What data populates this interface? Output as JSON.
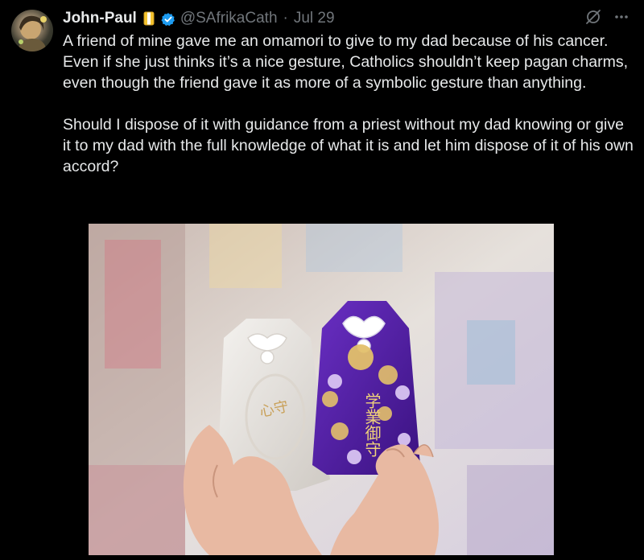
{
  "tweet": {
    "display_name": "John-Paul",
    "handle": "@SAfrikaCath",
    "separator": "·",
    "date": "Jul 29",
    "paragraphs": [
      "A friend of mine gave me an omamori to give to my dad because of his cancer. Even if she just thinks it’s a nice gesture, Catholics shouldn’t keep pagan charms, even though the friend gave it as more of a symbolic gesture than anything.",
      "Should I dispose of it with guidance from a priest without my dad knowing or give it to my dad with the full knowledge of what it is and let him dispose of it of his own accord?"
    ],
    "image": {
      "white_charm_text": "心守",
      "purple_charm_text": "学業御守"
    }
  },
  "icons": {
    "badge": "flag-emoji-icon",
    "verified": "verified-check-icon",
    "grok": "grok-icon",
    "more": "more-dots-icon"
  },
  "colors": {
    "background": "#000000",
    "text": "#e7e9ea",
    "secondary": "#71767b",
    "verified": "#1d9bf0",
    "purple_charm": "#4b1a9a"
  }
}
